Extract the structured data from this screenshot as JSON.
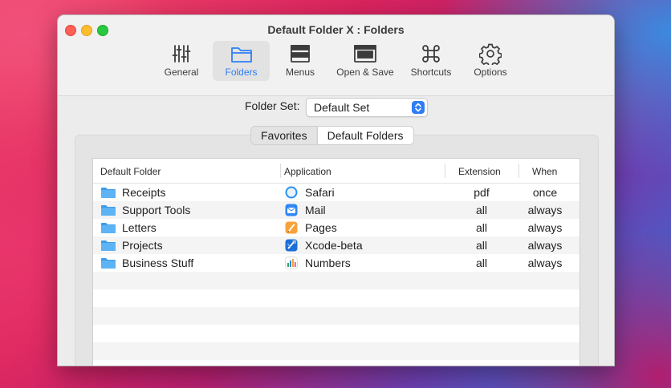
{
  "window": {
    "title": "Default Folder X : Folders"
  },
  "toolbar": {
    "items": [
      {
        "label": "General",
        "icon": "sliders-icon"
      },
      {
        "label": "Folders",
        "icon": "folder-icon",
        "active": true
      },
      {
        "label": "Menus",
        "icon": "menus-icon"
      },
      {
        "label": "Open & Save",
        "icon": "open-save-icon"
      },
      {
        "label": "Shortcuts",
        "icon": "command-icon"
      },
      {
        "label": "Options",
        "icon": "gear-icon"
      }
    ]
  },
  "folder_set": {
    "label": "Folder Set:",
    "value": "Default Set"
  },
  "segmented": {
    "favorites": "Favorites",
    "default_folders": "Default Folders",
    "selected": "Default Folders"
  },
  "table": {
    "headers": {
      "folder": "Default Folder",
      "application": "Application",
      "extension": "Extension",
      "when": "When"
    },
    "rows": [
      {
        "folder": "Receipts",
        "app": "Safari",
        "app_icon": "safari-icon",
        "ext": "pdf",
        "when": "once"
      },
      {
        "folder": "Support Tools",
        "app": "Mail",
        "app_icon": "mail-icon",
        "ext": "all",
        "when": "always"
      },
      {
        "folder": "Letters",
        "app": "Pages",
        "app_icon": "pages-icon",
        "ext": "all",
        "when": "always"
      },
      {
        "folder": "Projects",
        "app": "Xcode-beta",
        "app_icon": "xcode-icon",
        "ext": "all",
        "when": "always"
      },
      {
        "folder": "Business Stuff",
        "app": "Numbers",
        "app_icon": "numbers-icon",
        "ext": "all",
        "when": "always"
      }
    ]
  },
  "colors": {
    "accent": "#2f7df6",
    "folder": "#3d9be9"
  }
}
